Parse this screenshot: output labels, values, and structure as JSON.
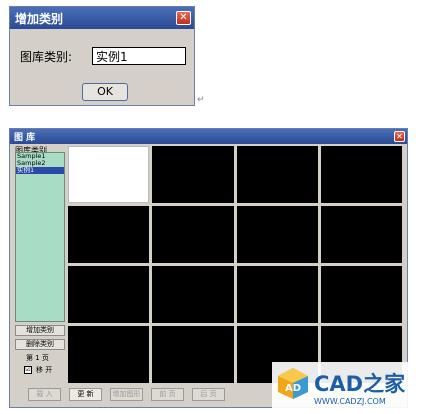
{
  "add_dialog": {
    "title": "增加类别",
    "field_label": "图库类别:",
    "field_value": "实例1",
    "ok_label": "OK"
  },
  "gallery": {
    "title": "图 库",
    "panel_label": "图库类别",
    "categories": [
      {
        "label": "Sample1",
        "selected": false
      },
      {
        "label": "Sample2",
        "selected": false
      },
      {
        "label": "实例1",
        "selected": true
      }
    ],
    "add_category_label": "增加类别",
    "delete_category_label": "删除类别",
    "page_label": "第 1 页",
    "checkbox_label": "移 开",
    "checkbox_mark": "☑",
    "bottom_buttons": [
      {
        "label": "载 入",
        "enabled": false
      },
      {
        "label": "更 新",
        "enabled": true
      },
      {
        "label": "增加图形",
        "enabled": false
      },
      {
        "label": "前 页",
        "enabled": false
      },
      {
        "label": "后 页",
        "enabled": false
      }
    ],
    "first_cell_white": true
  },
  "watermark": {
    "logo_text": "AD",
    "brand": "CAD之家",
    "url": "WWW.CADZJ.COM"
  },
  "colors": {
    "title_bar": "#2a4a94",
    "listbox_bg": "#a8dcc4",
    "selection": "#2a4aa8",
    "brand": "#1c5fa8"
  }
}
